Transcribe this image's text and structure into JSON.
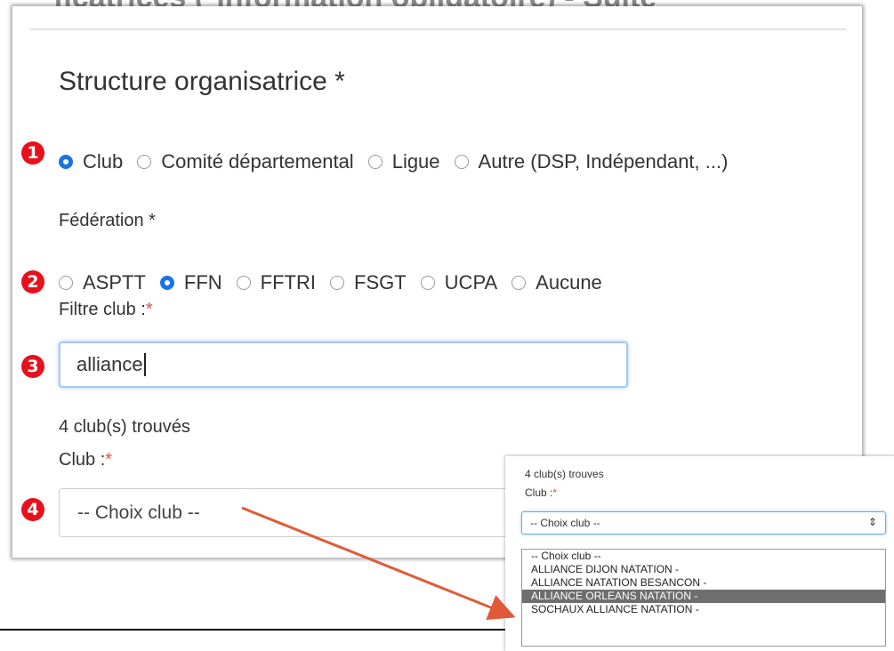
{
  "header_partial": "ficatrices (*information obligatoire) - Suite",
  "section": {
    "title": "Structure organisatrice *",
    "structure_options": [
      "Club",
      "Comité départemental",
      "Ligue",
      "Autre (DSP, Indépendant, ...)"
    ],
    "structure_selected": "Club",
    "federation_label": "Fédération *",
    "federation_options": [
      "ASPTT",
      "FFN",
      "FFTRI",
      "FSGT",
      "UCPA",
      "Aucune"
    ],
    "federation_selected": "FFN",
    "filter_label": "Filtre club :",
    "filter_value": "alliance",
    "found_text": "4 club(s) trouvés",
    "club_label": "Club :",
    "required_mark": "*",
    "club_select_value": "-- Choix club --"
  },
  "markers": [
    "1",
    "2",
    "3",
    "4"
  ],
  "inset": {
    "found_text": "4 club(s) trouves",
    "club_label": "Club :",
    "required_mark": "*",
    "select_value": "-- Choix club --",
    "select_arrows": "⇕",
    "options": [
      "-- Choix club --",
      "ALLIANCE DIJON NATATION -",
      "ALLIANCE NATATION BESANCON -",
      "ALLIANCE ORLEANS NATATION -",
      "SOCHAUX ALLIANCE NATATION -"
    ],
    "highlighted_option": "ALLIANCE ORLEANS NATATION -"
  },
  "colors": {
    "radio_accent": "#1a73e8",
    "marker_red": "#e8101a",
    "arrow": "#e05a3a",
    "highlight_row": "#6e6e6e"
  },
  "icons": {
    "marker": "numbered-red-circle",
    "radio": "radio-button",
    "select_arrows": "select-up-down-arrows",
    "callout_arrow": "annotation-arrow"
  }
}
